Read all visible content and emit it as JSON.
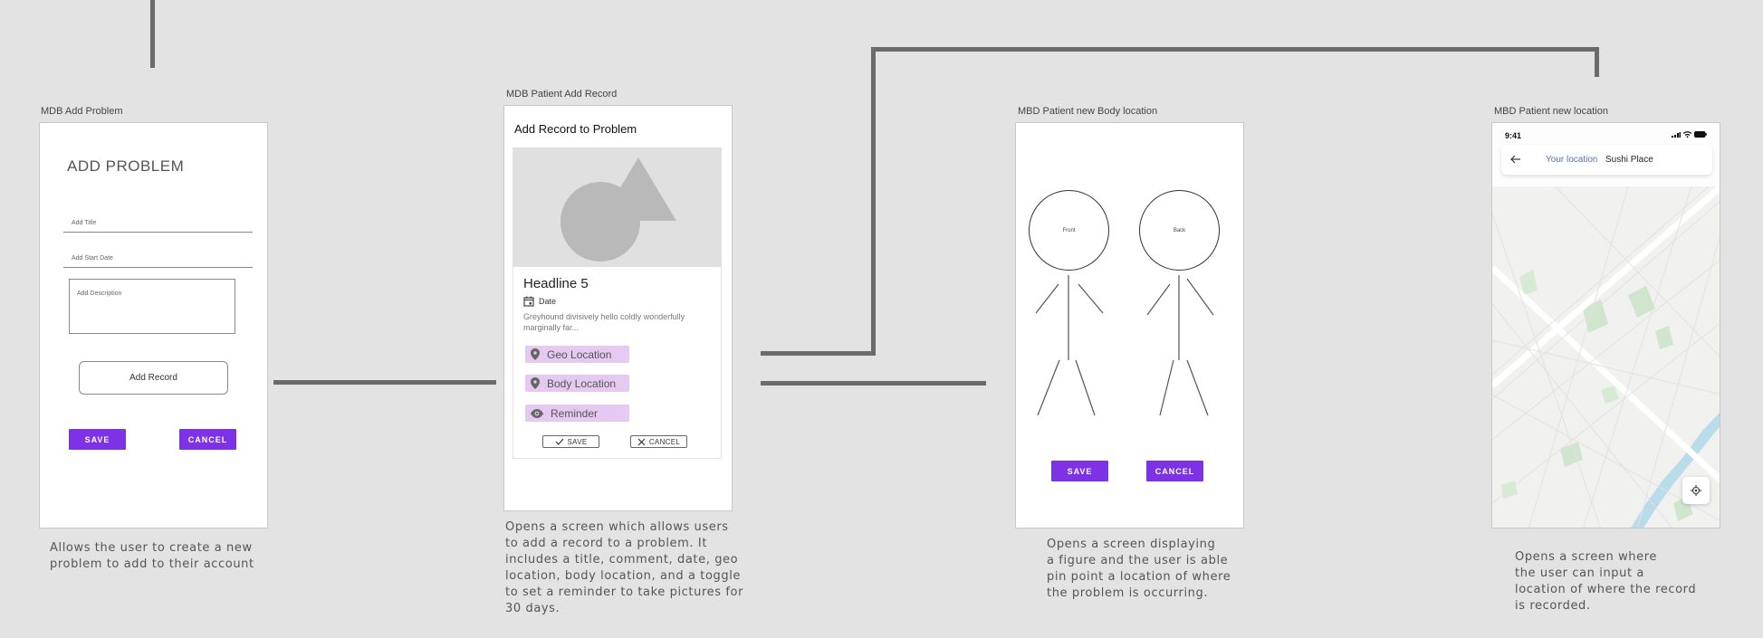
{
  "frames": {
    "add_problem": {
      "label": "MDB Add Problem",
      "heading": "ADD PROBLEM",
      "title_placeholder": "Add Title",
      "start_date_placeholder": "Add Start Date",
      "description_placeholder": "Add Description",
      "add_record_label": "Add Record",
      "save_label": "SAVE",
      "cancel_label": "CANCEL",
      "caption": "Allows the user to create a new\nproblem to add to their account"
    },
    "add_record": {
      "label": "MDB Patient Add Record",
      "heading": "Add Record to Problem",
      "headline": "Headline 5",
      "date_label": "Date",
      "body": "Greyhound divisively hello coldly wonderfully marginally far...",
      "chips": [
        "Geo Location",
        "Body Location",
        "Reminder"
      ],
      "save_label": "SAVE",
      "cancel_label": "CANCEL",
      "caption": "Opens a screen which allows users\nto add a record to a problem. It\nincludes a title, comment, date, geo\nlocation, body location, and a toggle\nto set a reminder to take pictures for\n30 days."
    },
    "body_location": {
      "label": "MBD Patient new Body location",
      "front_label": "Front",
      "back_label": "Back",
      "save_label": "SAVE",
      "cancel_label": "CANCEL",
      "caption": "Opens a screen displaying\na figure and the user is able\npin point a location of where\nthe problem is occurring."
    },
    "new_location": {
      "label": "MBD Patient new location",
      "time": "9:41",
      "breadcrumb_from": "Your location",
      "breadcrumb_to": "Sushi Place",
      "caption": "Opens a screen where\nthe user can input a\nlocation of where the record\nis recorded."
    }
  },
  "colors": {
    "accent": "#7e32e6",
    "chip": "#e5c9f0",
    "connector": "#6b6b6b",
    "canvas": "#e3e3e3"
  }
}
